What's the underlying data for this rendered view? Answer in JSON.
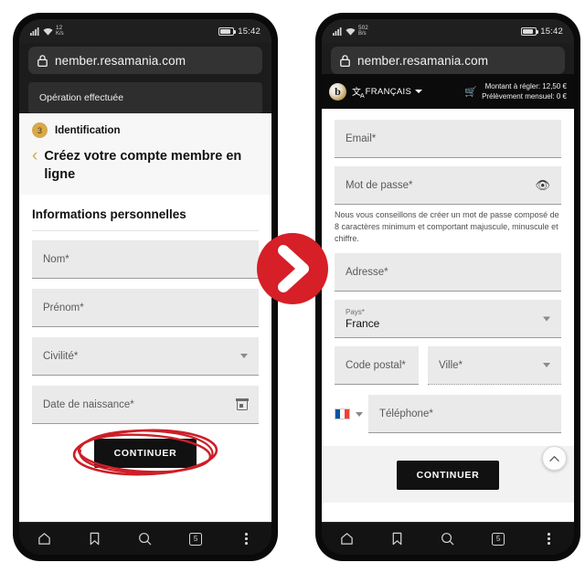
{
  "left_phone": {
    "statusbar": {
      "network_speed_value": "12",
      "network_speed_unit": "K/s",
      "time": "15:42",
      "signal_icon": "cellular-signal-icon",
      "wifi_icon": "wifi-icon",
      "battery_icon": "battery-icon"
    },
    "urlbar": {
      "lock_icon": "lock-icon",
      "url": "nember.resamania.com"
    },
    "toast": {
      "message": "Opération effectuée"
    },
    "step": {
      "number": "3",
      "label": "Identification"
    },
    "title": "Créez votre compte membre en ligne",
    "back_icon": "chevron-left-icon",
    "section_heading": "Informations personnelles",
    "fields": [
      {
        "label": "Nom*",
        "icon": null
      },
      {
        "label": "Prénom*",
        "icon": null
      },
      {
        "label": "Civilité*",
        "icon": "chevron-down-icon"
      },
      {
        "label": "Date de naissance*",
        "icon": "calendar-icon"
      }
    ],
    "cta_label": "CONTINUER",
    "annotation": {
      "shape": "hand-drawn-ellipse",
      "color": "#cc1f28"
    },
    "bottomnav": [
      {
        "icon": "home-icon",
        "label": ""
      },
      {
        "icon": "bookmark-icon",
        "label": ""
      },
      {
        "icon": "search-icon",
        "label": ""
      },
      {
        "icon": "tab-count-icon",
        "label": "5"
      },
      {
        "icon": "overflow-menu-icon",
        "label": ""
      }
    ]
  },
  "right_phone": {
    "statusbar": {
      "network_speed_value": "502",
      "network_speed_unit": "B/s",
      "time": "15:42",
      "signal_icon": "cellular-signal-icon",
      "wifi_icon": "wifi-icon",
      "battery_icon": "battery-icon"
    },
    "urlbar": {
      "lock_icon": "lock-icon",
      "url": "nember.resamania.com"
    },
    "site_header": {
      "logo_letter": "b",
      "translate_icon": "translate-icon",
      "language": "FRANÇAIS",
      "language_caret": "chevron-down-icon",
      "cart_icon": "cart-icon",
      "amount_due": "Montant à régler: 12,50 €",
      "monthly_debit": "Prélèvement mensuel: 0 €"
    },
    "fields": {
      "email": {
        "label": "Email*"
      },
      "password": {
        "label": "Mot de passe*",
        "icon": "eye-icon"
      },
      "password_hint": "Nous vous conseillons de créer un mot de passe composé de 8 caractères minimum et comportant majuscule, minuscule et chiffre.",
      "address": {
        "label": "Adresse*"
      },
      "country": {
        "label": "Pays*",
        "value": "France",
        "icon": "chevron-down-icon"
      },
      "postal_code": {
        "label": "Code postal*"
      },
      "city": {
        "label": "Ville*",
        "icon": "chevron-down-icon"
      },
      "phone": {
        "label": "Téléphone*",
        "flag": "france-flag-icon",
        "flag_caret": "chevron-down-icon"
      }
    },
    "fab": {
      "icon": "chevron-up-icon"
    },
    "cta_label": "CONTINUER",
    "bottomnav": [
      {
        "icon": "home-icon",
        "label": ""
      },
      {
        "icon": "bookmark-icon",
        "label": ""
      },
      {
        "icon": "search-icon",
        "label": ""
      },
      {
        "icon": "tab-count-icon",
        "label": "5"
      },
      {
        "icon": "overflow-menu-icon",
        "label": ""
      }
    ]
  },
  "transition": {
    "icon": "chevron-right-arrow-icon",
    "color": "#d61f26"
  }
}
